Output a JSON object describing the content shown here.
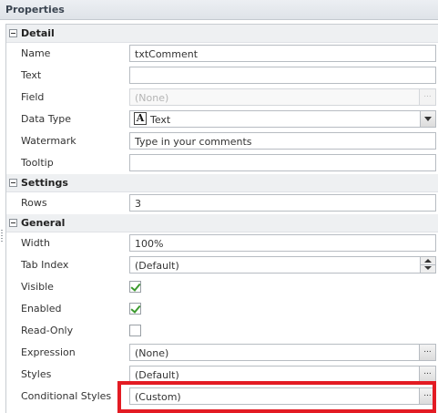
{
  "panel": {
    "title": "Properties"
  },
  "sections": {
    "detail": {
      "label": "Detail"
    },
    "settings": {
      "label": "Settings"
    },
    "general": {
      "label": "General"
    }
  },
  "detail": {
    "name": {
      "label": "Name",
      "value": "txtComment"
    },
    "text": {
      "label": "Text",
      "value": ""
    },
    "field": {
      "label": "Field",
      "value": "(None)",
      "button": "..."
    },
    "data_type": {
      "label": "Data Type",
      "value": "Text",
      "icon_glyph": "A"
    },
    "watermark": {
      "label": "Watermark",
      "value": "Type in your comments"
    },
    "tooltip": {
      "label": "Tooltip",
      "value": ""
    }
  },
  "settings": {
    "rows": {
      "label": "Rows",
      "value": "3"
    }
  },
  "general": {
    "width": {
      "label": "Width",
      "value": "100%"
    },
    "tab_index": {
      "label": "Tab Index",
      "value": "(Default)"
    },
    "visible": {
      "label": "Visible",
      "checked": true
    },
    "enabled": {
      "label": "Enabled",
      "checked": true
    },
    "read_only": {
      "label": "Read-Only",
      "checked": false
    },
    "expression": {
      "label": "Expression",
      "value": "(None)",
      "button": "..."
    },
    "styles": {
      "label": "Styles",
      "value": "(Default)",
      "button": "..."
    },
    "conditional_styles": {
      "label": "Conditional Styles",
      "value": "(Custom)",
      "button": "..."
    }
  },
  "colors": {
    "highlight": "#e31b23",
    "check": "#3c9a2e",
    "section_bg": "#eef0f2"
  }
}
